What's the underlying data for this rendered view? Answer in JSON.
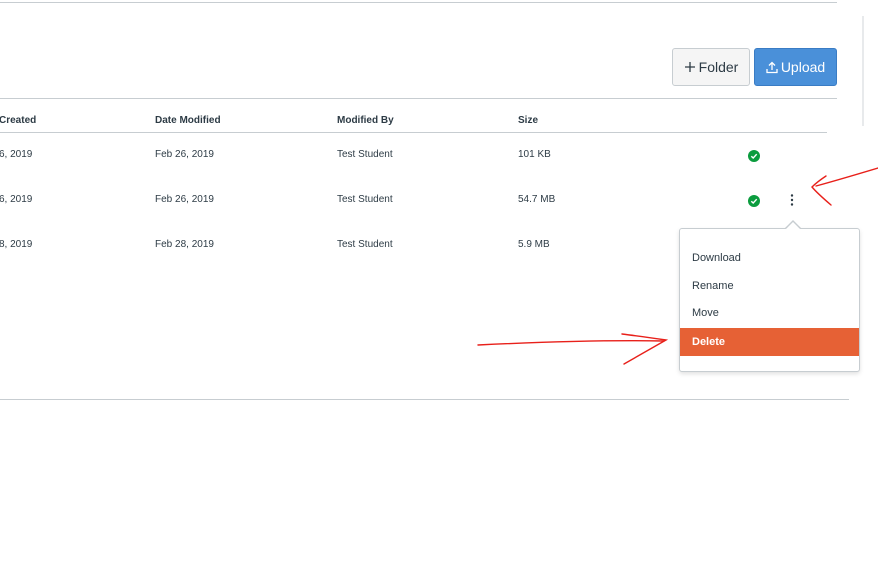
{
  "toolbar": {
    "folder_label": "Folder",
    "upload_label": "Upload",
    "upload_color": "#4a90d9"
  },
  "table": {
    "columns": [
      "Created",
      "Date Modified",
      "Modified By",
      "Size"
    ],
    "rows": [
      {
        "created": "6, 2019",
        "modified": "Feb 26, 2019",
        "modified_by": "Test Student",
        "size": "101 KB",
        "status": "published-check-icon"
      },
      {
        "created": "6, 2019",
        "modified": "Feb 26, 2019",
        "modified_by": "Test Student",
        "size": "54.7 MB",
        "status": "published-check-icon"
      },
      {
        "created": "8, 2019",
        "modified": "Feb 28, 2019",
        "modified_by": "Test Student",
        "size": "5.9 MB",
        "status": ""
      }
    ]
  },
  "menu": {
    "items": [
      "Download",
      "Rename",
      "Move",
      "Delete"
    ],
    "highlighted": "Delete",
    "highlight_color": "#e66135"
  },
  "annotation": {
    "color": "#e8201a"
  }
}
